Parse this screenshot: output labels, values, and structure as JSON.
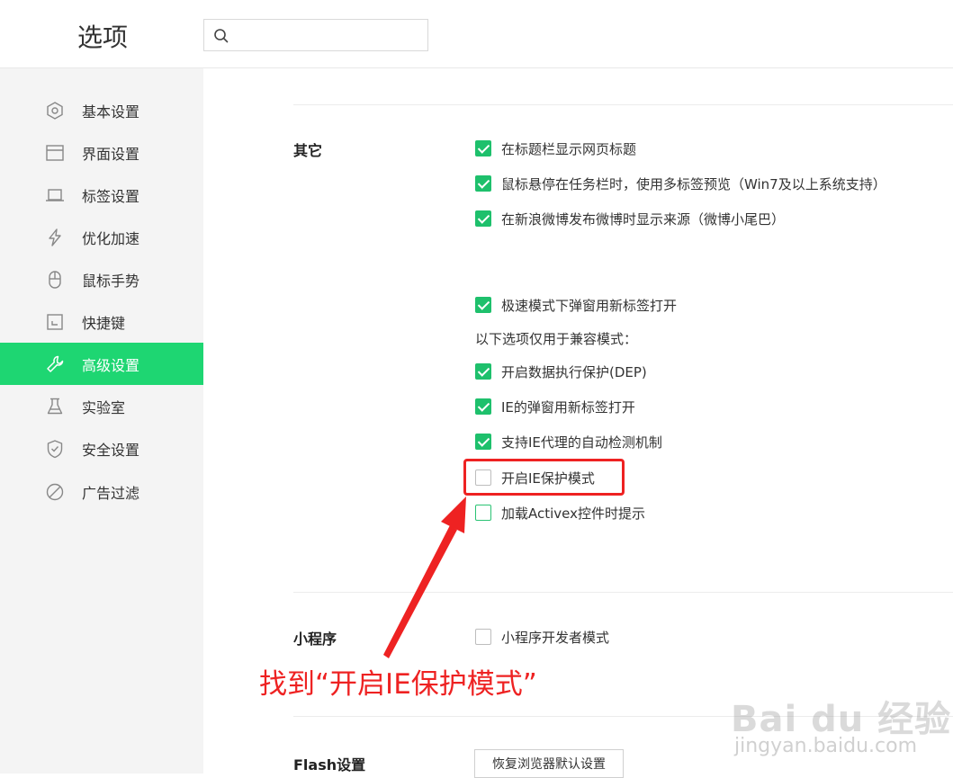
{
  "header": {
    "title": "选项",
    "search_placeholder": ""
  },
  "sidebar": {
    "items": [
      {
        "label": "基本设置",
        "icon": "hexagon-icon"
      },
      {
        "label": "界面设置",
        "icon": "window-icon"
      },
      {
        "label": "标签设置",
        "icon": "tab-icon"
      },
      {
        "label": "优化加速",
        "icon": "lightning-icon"
      },
      {
        "label": "鼠标手势",
        "icon": "mouse-icon"
      },
      {
        "label": "快捷键",
        "icon": "shortcut-icon"
      },
      {
        "label": "高级设置",
        "icon": "wrench-icon",
        "active": true
      },
      {
        "label": "实验室",
        "icon": "flask-icon"
      },
      {
        "label": "安全设置",
        "icon": "shield-icon"
      },
      {
        "label": "广告过滤",
        "icon": "block-icon"
      }
    ]
  },
  "sections": {
    "other": {
      "title": "其它",
      "options": [
        {
          "label": "在标题栏显示网页标题",
          "checked": true
        },
        {
          "label": "鼠标悬停在任务栏时，使用多标签预览（Win7及以上系统支持）",
          "checked": true
        },
        {
          "label": "在新浪微博发布微博时显示来源（微博小尾巴）",
          "checked": true
        },
        {
          "label": "极速模式下弹窗用新标签打开",
          "checked": true
        }
      ],
      "compat_note": "以下选项仅用于兼容模式：",
      "compat_options": [
        {
          "label": "开启数据执行保护(DEP)",
          "checked": true
        },
        {
          "label": "IE的弹窗用新标签打开",
          "checked": true
        },
        {
          "label": "支持IE代理的自动检测机制",
          "checked": true
        },
        {
          "label": "开启IE保护模式",
          "checked": false
        },
        {
          "label": "加载Activex控件时提示",
          "checked": false
        }
      ]
    },
    "miniprogram": {
      "title": "小程序",
      "option": {
        "label": "小程序开发者模式",
        "checked": false
      }
    },
    "flash": {
      "title": "Flash设置",
      "button_label": "恢复浏览器默认设置"
    }
  },
  "annotation": {
    "caption": "找到“开启IE保护模式”",
    "color": "#ee2222"
  },
  "watermark": {
    "brand": "Bai du 经验",
    "sub": "jingyan.baidu.com"
  },
  "colors": {
    "accent": "#1ed672",
    "checkbox": "#1ec06c",
    "sidebar_bg": "#f4f4f4"
  }
}
